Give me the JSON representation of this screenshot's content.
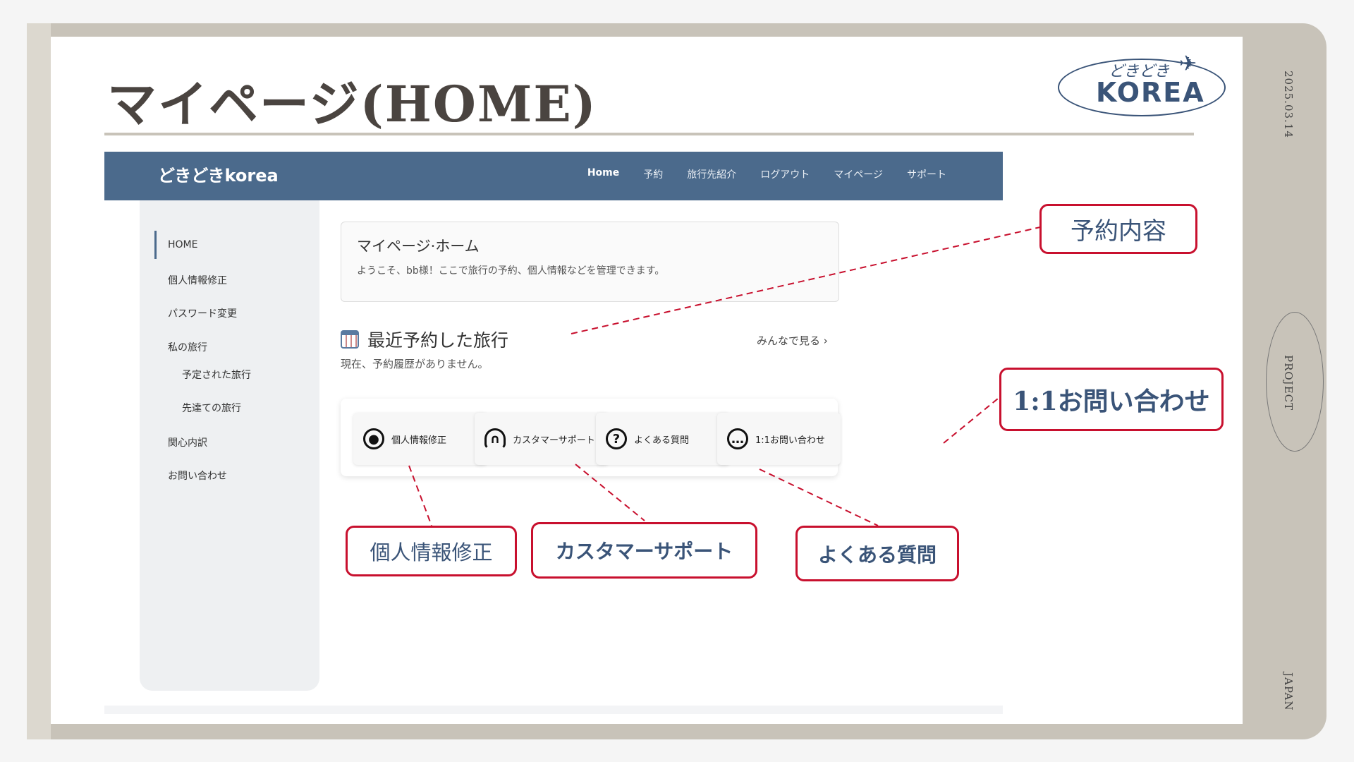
{
  "slide": {
    "title": "マイページ(HOME)",
    "date": "2025.03.14",
    "project_label": "PROJECT",
    "country_label": "JAPAN",
    "logo_top": "どきどき",
    "logo_main": "KOREA"
  },
  "app": {
    "brand": "どきどきkorea",
    "nav": [
      "Home",
      "予約",
      "旅行先紹介",
      "ログアウト",
      "マイページ",
      "サポート"
    ],
    "sidebar": {
      "items": [
        {
          "label": "HOME",
          "active": true
        },
        {
          "label": "個人情報修正"
        },
        {
          "label": "パスワード変更"
        },
        {
          "label": "私の旅行"
        },
        {
          "label": "予定された旅行",
          "sub": true
        },
        {
          "label": "先達ての旅行",
          "sub": true
        },
        {
          "label": "関心内訳"
        },
        {
          "label": "お問い合わせ"
        }
      ]
    },
    "welcome": {
      "title": "マイページ·ホーム",
      "text": "ようこそ、bb様！ここで旅行の予約、個人情報などを管理できます。"
    },
    "recent": {
      "title": "最近予約した旅行",
      "see_all": "みんなで見る ›",
      "empty": "現在、予約履歴がありません。"
    },
    "quick_actions": [
      {
        "label": "個人情報修正",
        "icon": "user-circle-icon",
        "glyph": "●"
      },
      {
        "label": "カスタマーサポート",
        "icon": "headset-icon",
        "glyph": "∩"
      },
      {
        "label": "よくある質問",
        "icon": "question-icon",
        "glyph": "?"
      },
      {
        "label": "1:1お問い合わせ",
        "icon": "chat-icon",
        "glyph": "…"
      }
    ]
  },
  "annotations": {
    "reservation": "予約内容",
    "inquiry": "1:1お問い合わせ",
    "profile": "個人情報修正",
    "support": "カスタマーサポート",
    "faq": "よくある質問"
  },
  "colors": {
    "accent": "#4b6a8c",
    "annotation_border": "#c8102e",
    "frame": "#c8c3b9"
  }
}
